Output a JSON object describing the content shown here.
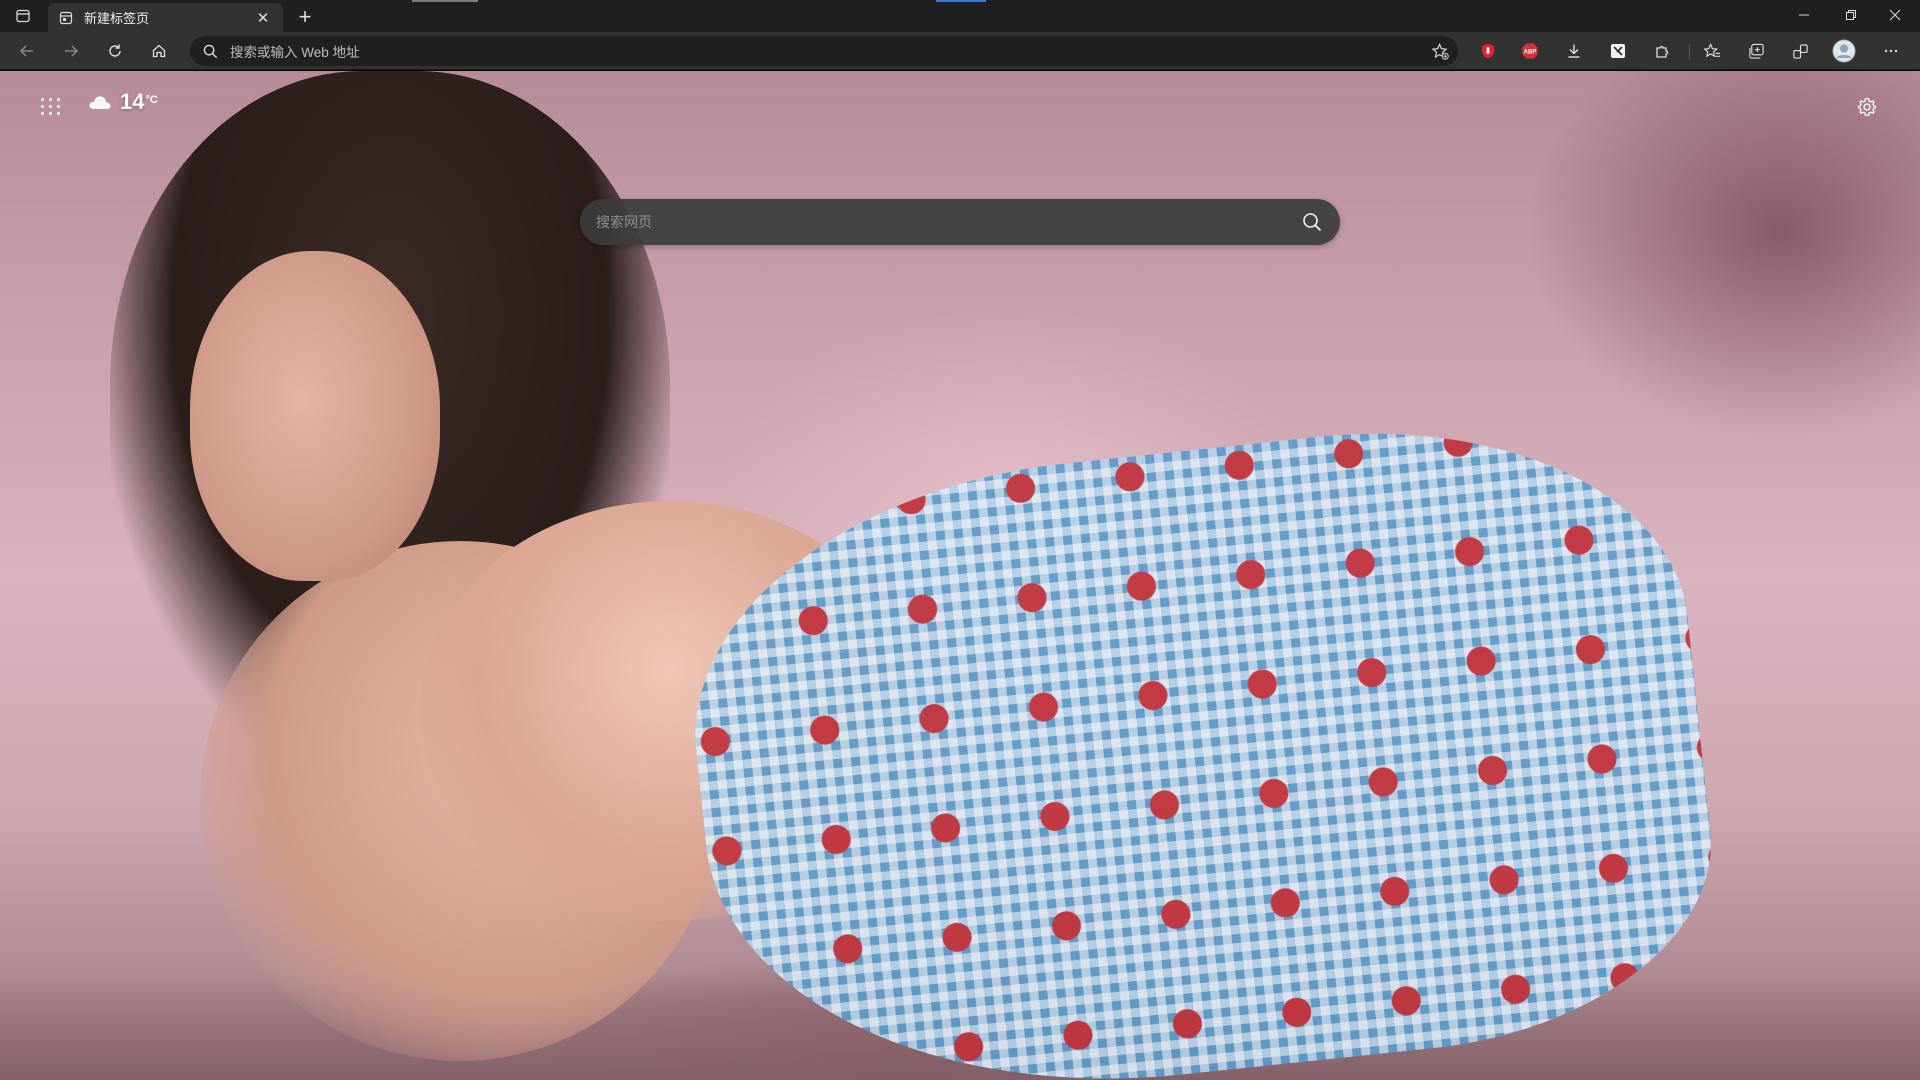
{
  "tabs": [
    {
      "title": "新建标签页",
      "favicon": "page-icon",
      "active": true
    }
  ],
  "omnibox": {
    "placeholder": "搜索或输入 Web 地址"
  },
  "toolbar": {
    "back": "back-arrow-icon",
    "forward": "forward-arrow-icon",
    "refresh": "refresh-icon",
    "home": "home-icon",
    "extensions": [
      "adblock-red-icon",
      "abp-icon",
      "download-icon",
      "extension-tile-icon",
      "puzzle-icon"
    ],
    "right": [
      "favorites-icon",
      "collections-icon",
      "sync-icon",
      "profile-avatar",
      "more-icon"
    ]
  },
  "newtab": {
    "weather": {
      "temperature": "14",
      "unit": "°C",
      "condition_icon": "cloud-icon"
    },
    "search": {
      "placeholder": "搜索网页"
    }
  },
  "colors": {
    "tabstrip": "#202020",
    "toolbar": "#323232",
    "omnibox": "#202020",
    "search_box": "#3c3c3c",
    "abp_badge": "#d9303a",
    "extension_red": "#e0202e"
  }
}
